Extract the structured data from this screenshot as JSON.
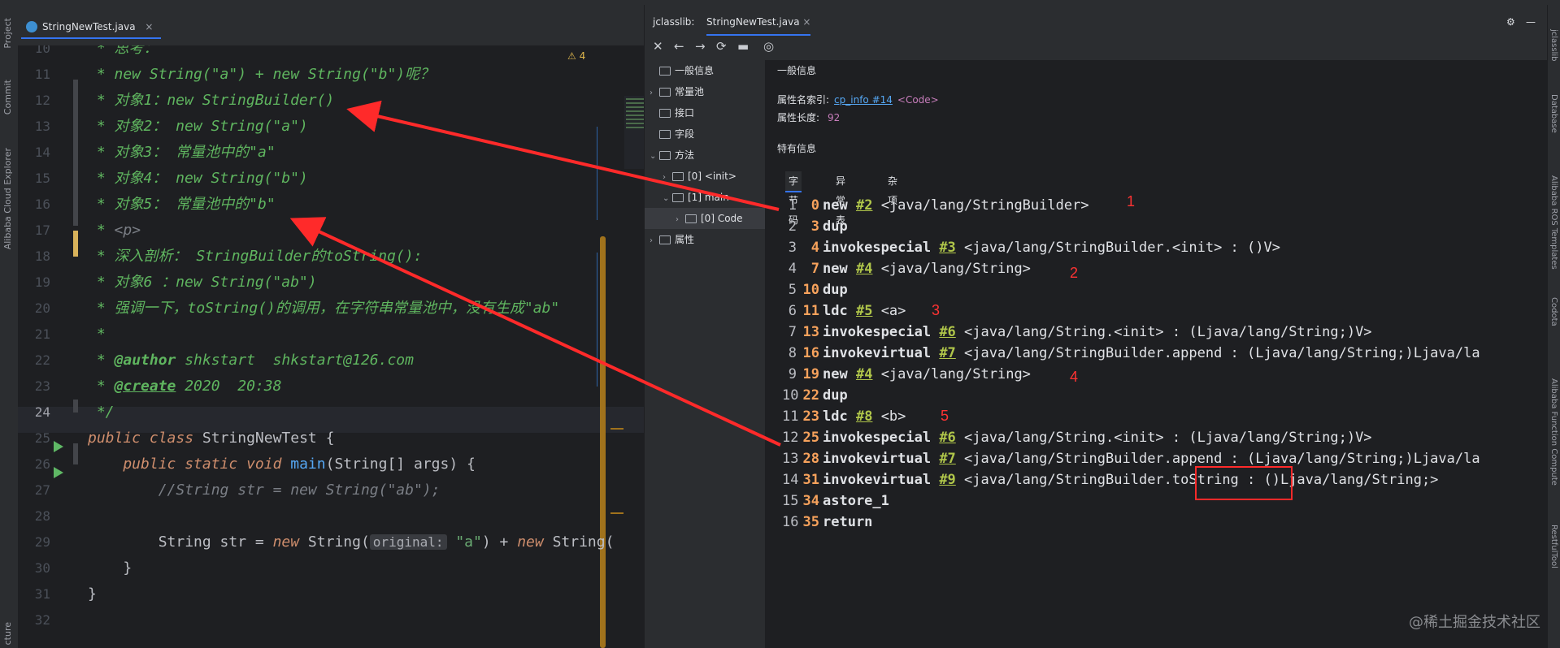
{
  "left_strip": [
    "Project",
    "Commit",
    "Alibaba Cloud Explorer",
    "cture"
  ],
  "editor_tab": {
    "filename": "StringNewTest.java",
    "close": "×"
  },
  "editor": {
    "warning_count": "4",
    "lines": [
      {
        "n": "10"
      },
      {
        "n": "11"
      },
      {
        "n": "12"
      },
      {
        "n": "13"
      },
      {
        "n": "14"
      },
      {
        "n": "15"
      },
      {
        "n": "16"
      },
      {
        "n": "17"
      },
      {
        "n": "18"
      },
      {
        "n": "19"
      },
      {
        "n": "20"
      },
      {
        "n": "21"
      },
      {
        "n": "22"
      },
      {
        "n": "23"
      },
      {
        "n": "24"
      },
      {
        "n": "25"
      },
      {
        "n": "26"
      },
      {
        "n": "27"
      },
      {
        "n": "28"
      },
      {
        "n": "29"
      },
      {
        "n": "30"
      },
      {
        "n": "31"
      },
      {
        "n": "32"
      }
    ],
    "text": {
      "l10": " * 思考：",
      "l11": " * new String(\"a\") + new String(\"b\")呢？",
      "l12": " * 对象1：new StringBuilder()",
      "l13": " * 对象2： new String(\"a\")",
      "l14": " * 对象3： 常量池中的\"a\"",
      "l15": " * 对象4： new String(\"b\")",
      "l16": " * 对象5： 常量池中的\"b\"",
      "l17_a": " * ",
      "l17_b": "<p>",
      "l18": " * 深入剖析： StringBuilder的toString():",
      "l19": " * 对象6 ：new String(\"ab\")",
      "l20": " * 强调一下，toString()的调用，在字符串常量池中，没有生成\"ab\"",
      "l21": " *",
      "l22_a": " * ",
      "l22_tag": "@author",
      "l22_b": " shkstart  shkstart@126.com",
      "l23_a": " * ",
      "l23_tag": "@create",
      "l23_b": " 2020  20:38",
      "l24": " */",
      "l25_kw": "public class ",
      "l25_name": "StringNewTest",
      "l25_end": " {",
      "l26_kw": "    public static void ",
      "l26_fn": "main",
      "l26_args": "(String[] args) {",
      "l27": "        //String str = new String(\"ab\");",
      "l29_a": "        String str = ",
      "l29_new1": "new",
      "l29_b": " String(",
      "l29_hint": "original:",
      "l29_str": " \"a\"",
      "l29_c": ") + ",
      "l29_new2": "new",
      "l29_d": " String(",
      "l30": "    }",
      "l31": "}"
    }
  },
  "panel_tabs": [
    "jclasslib:",
    "StringNewTest.java"
  ],
  "panel_tab_close": "×",
  "toolbar_icons": [
    "✕",
    "←",
    "→",
    "⟳",
    "▬",
    "◎"
  ],
  "tree": [
    {
      "label": "一般信息",
      "arrow": ""
    },
    {
      "label": "常量池",
      "arrow": "›"
    },
    {
      "label": "接口",
      "arrow": ""
    },
    {
      "label": "字段",
      "arrow": ""
    },
    {
      "label": "方法",
      "arrow": "⌄"
    },
    {
      "label": "[0] <init>",
      "arrow": "›"
    },
    {
      "label": "[1] main",
      "arrow": "⌄"
    },
    {
      "label": "[0] Code",
      "arrow": "›"
    },
    {
      "label": "属性",
      "arrow": "›"
    }
  ],
  "detail": {
    "general_title": "一般信息",
    "attr_name_label": "属性名索引:",
    "attr_name_link": "cp_info #14",
    "attr_name_value": "<Code>",
    "attr_len_label": "属性长度:",
    "attr_len_value": "92",
    "specific_title": "特有信息",
    "subtabs": [
      "字节码",
      "异常表",
      "杂项"
    ]
  },
  "bytecode": [
    {
      "ln": "1",
      "off": "0",
      "op": "new",
      "ref": "#2",
      "arg": " <java/lang/StringBuilder>"
    },
    {
      "ln": "2",
      "off": "3",
      "op": "dup",
      "ref": "",
      "arg": ""
    },
    {
      "ln": "3",
      "off": "4",
      "op": "invokespecial",
      "ref": "#3",
      "arg": " <java/lang/StringBuilder.<init> : ()V>"
    },
    {
      "ln": "4",
      "off": "7",
      "op": "new",
      "ref": "#4",
      "arg": " <java/lang/String>"
    },
    {
      "ln": "5",
      "off": "10",
      "op": "dup",
      "ref": "",
      "arg": ""
    },
    {
      "ln": "6",
      "off": "11",
      "op": "ldc",
      "ref": "#5",
      "arg": " <a>"
    },
    {
      "ln": "7",
      "off": "13",
      "op": "invokespecial",
      "ref": "#6",
      "arg": " <java/lang/String.<init> : (Ljava/lang/String;)V>"
    },
    {
      "ln": "8",
      "off": "16",
      "op": "invokevirtual",
      "ref": "#7",
      "arg": " <java/lang/StringBuilder.append : (Ljava/lang/String;)Ljava/la"
    },
    {
      "ln": "9",
      "off": "19",
      "op": "new",
      "ref": "#4",
      "arg": " <java/lang/String>"
    },
    {
      "ln": "10",
      "off": "22",
      "op": "dup",
      "ref": "",
      "arg": ""
    },
    {
      "ln": "11",
      "off": "23",
      "op": "ldc",
      "ref": "#8",
      "arg": " <b>"
    },
    {
      "ln": "12",
      "off": "25",
      "op": "invokespecial",
      "ref": "#6",
      "arg": " <java/lang/String.<init> : (Ljava/lang/String;)V>"
    },
    {
      "ln": "13",
      "off": "28",
      "op": "invokevirtual",
      "ref": "#7",
      "arg": " <java/lang/StringBuilder.append : (Ljava/lang/String;)Ljava/la"
    },
    {
      "ln": "14",
      "off": "31",
      "op": "invokevirtual",
      "ref": "#9",
      "arg": " <java/lang/StringBuilder.toString : ()Ljava/lang/String;>"
    },
    {
      "ln": "15",
      "off": "34",
      "op": "astore_1",
      "ref": "",
      "arg": ""
    },
    {
      "ln": "16",
      "off": "35",
      "op": "return",
      "ref": "",
      "arg": ""
    }
  ],
  "annotations": [
    "1",
    "2",
    "3",
    "4",
    "5"
  ],
  "colors": {
    "annotation_red": "#ff2a2a",
    "doc_green": "#5fb55f",
    "offset_orange": "#f7a25c",
    "ref_olive": "#b0c64a"
  },
  "right_strip": [
    "jclasslib",
    "Database",
    "Alibaba ROS Templates",
    "Codota",
    "Alibaba Function Compute",
    "RestfulTool"
  ],
  "watermark": "@稀土掘金技术社区"
}
